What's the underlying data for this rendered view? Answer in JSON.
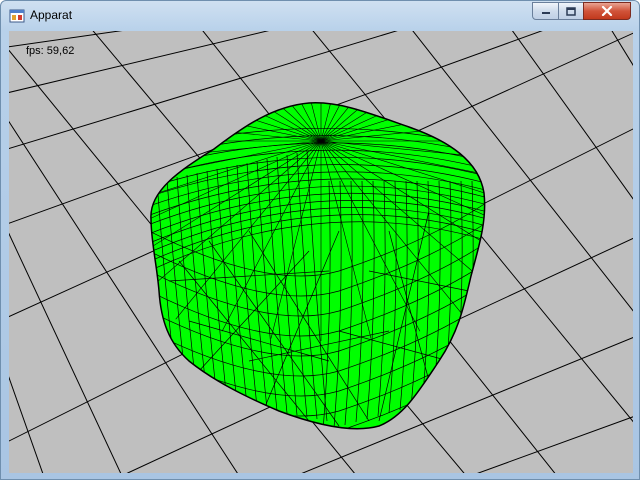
{
  "window": {
    "title": "Apparat",
    "controls": [
      "minimize",
      "maximize",
      "close"
    ]
  },
  "viewport": {
    "fps_label": "fps: 59,62",
    "background_color": "#bfbfbf",
    "grid_color": "#000000",
    "mesh_fill_color": "#00ff00",
    "mesh_wire_color": "#000000",
    "object": "rounded cube wireframe mesh"
  },
  "icons": {
    "app": "app-window-icon",
    "minimize": "minimize-icon",
    "maximize": "maximize-icon",
    "close": "close-icon"
  }
}
